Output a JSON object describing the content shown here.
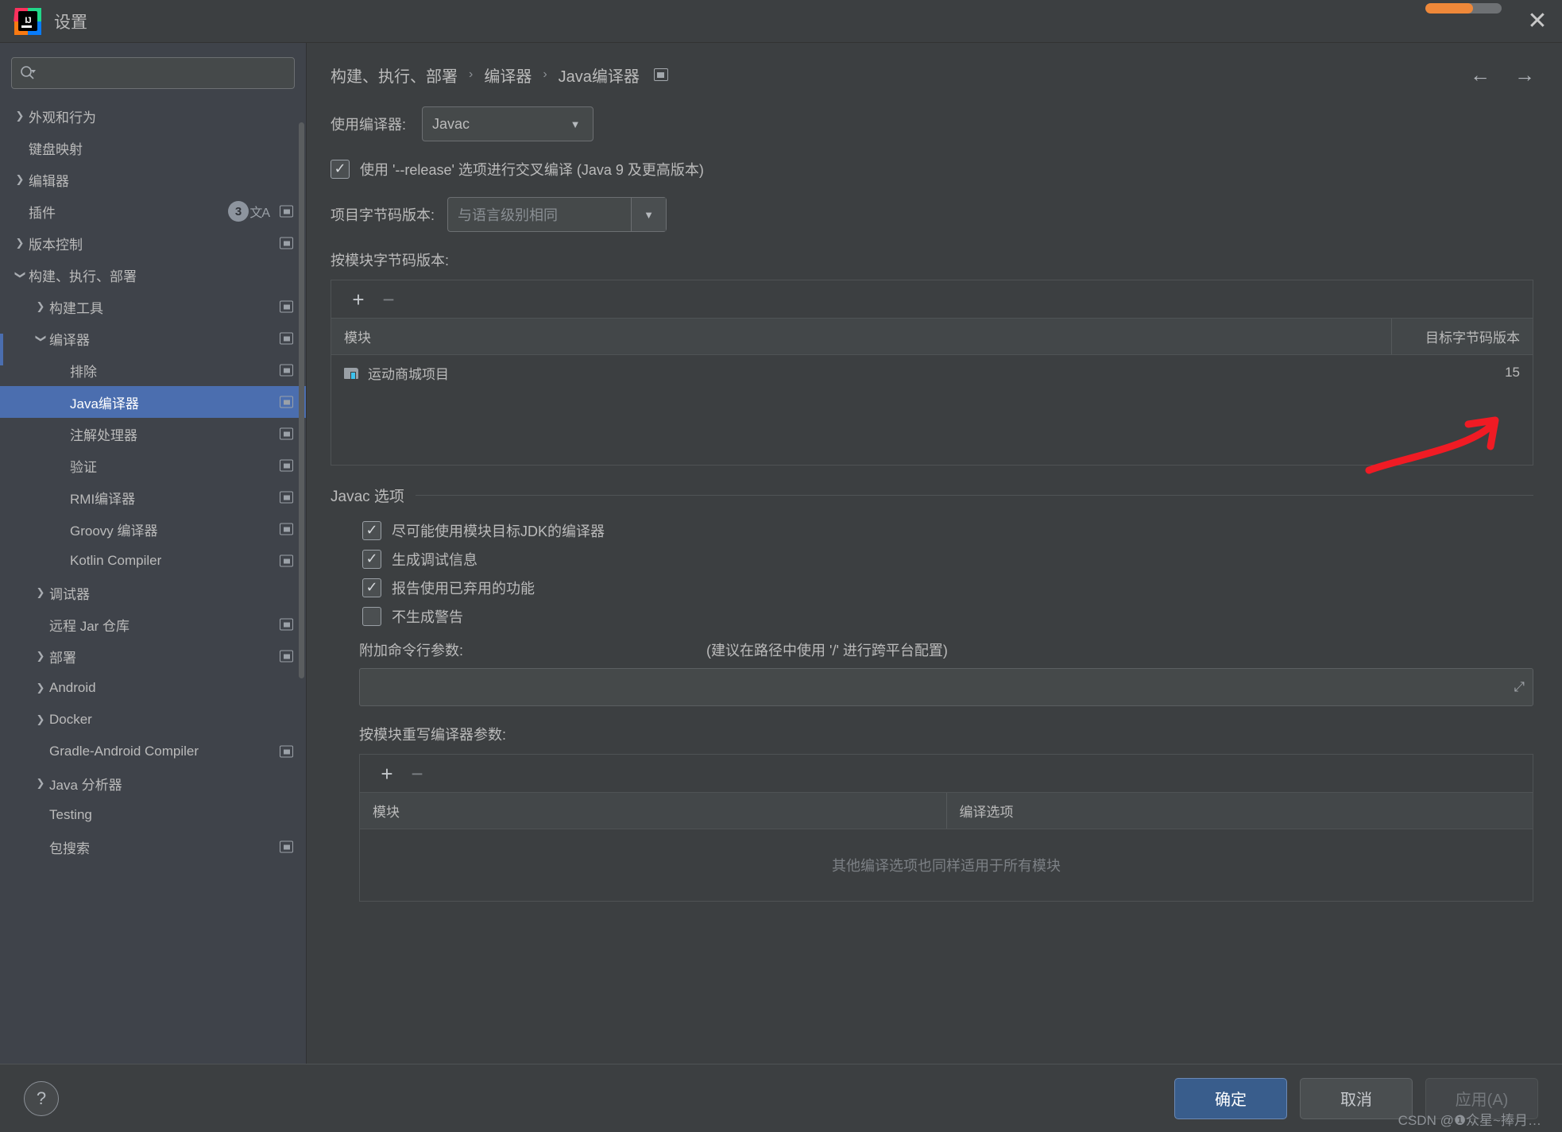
{
  "window": {
    "title": "设置",
    "logo_text": "IJ",
    "close_icon": "✕",
    "progress_percent": 62
  },
  "sidebar": {
    "search": {
      "value": "",
      "placeholder": ""
    },
    "items": [
      {
        "label": "外观和行为",
        "indent": 0,
        "arrow": "right",
        "selected": false
      },
      {
        "label": "键盘映射",
        "indent": 0,
        "arrow": "none",
        "selected": false
      },
      {
        "label": "编辑器",
        "indent": 0,
        "arrow": "right",
        "selected": false
      },
      {
        "label": "插件",
        "indent": 0,
        "arrow": "none",
        "selected": false,
        "badge": "3",
        "translate_icon": true,
        "gear": true
      },
      {
        "label": "版本控制",
        "indent": 0,
        "arrow": "right",
        "selected": false,
        "gear": true
      },
      {
        "label": "构建、执行、部署",
        "indent": 0,
        "arrow": "down",
        "selected": false
      },
      {
        "label": "构建工具",
        "indent": 1,
        "arrow": "right",
        "selected": false,
        "gear": true
      },
      {
        "label": "编译器",
        "indent": 1,
        "arrow": "down",
        "selected": false,
        "gear": true
      },
      {
        "label": "排除",
        "indent": 2,
        "arrow": "none",
        "selected": false,
        "gear": true
      },
      {
        "label": "Java编译器",
        "indent": 2,
        "arrow": "none",
        "selected": true,
        "gear": true
      },
      {
        "label": "注解处理器",
        "indent": 2,
        "arrow": "none",
        "selected": false,
        "gear": true
      },
      {
        "label": "验证",
        "indent": 2,
        "arrow": "none",
        "selected": false,
        "gear": true
      },
      {
        "label": "RMI编译器",
        "indent": 2,
        "arrow": "none",
        "selected": false,
        "gear": true
      },
      {
        "label": "Groovy 编译器",
        "indent": 2,
        "arrow": "none",
        "selected": false,
        "gear": true
      },
      {
        "label": "Kotlin Compiler",
        "indent": 2,
        "arrow": "none",
        "selected": false,
        "gear": true
      },
      {
        "label": "调试器",
        "indent": 1,
        "arrow": "right",
        "selected": false
      },
      {
        "label": "远程 Jar 仓库",
        "indent": 1,
        "arrow": "none",
        "selected": false,
        "gear": true
      },
      {
        "label": "部署",
        "indent": 1,
        "arrow": "right",
        "selected": false,
        "gear": true
      },
      {
        "label": "Android",
        "indent": 1,
        "arrow": "right",
        "selected": false
      },
      {
        "label": "Docker",
        "indent": 1,
        "arrow": "right",
        "selected": false
      },
      {
        "label": "Gradle-Android Compiler",
        "indent": 1,
        "arrow": "none",
        "selected": false,
        "gear": true
      },
      {
        "label": "Java 分析器",
        "indent": 1,
        "arrow": "right",
        "selected": false
      },
      {
        "label": "Testing",
        "indent": 1,
        "arrow": "none",
        "selected": false
      },
      {
        "label": "包搜索",
        "indent": 1,
        "arrow": "none",
        "selected": false,
        "gear": true
      }
    ]
  },
  "breadcrumb": {
    "items": [
      "构建、执行、部署",
      "编译器",
      "Java编译器"
    ],
    "separator": "›"
  },
  "main": {
    "compiler_label": "使用编译器:",
    "compiler_value": "Javac",
    "release_checkbox": {
      "label": "使用 '--release' 选项进行交叉编译 (Java 9 及更高版本)",
      "checked": true
    },
    "project_bytecode_label": "项目字节码版本:",
    "project_bytecode_placeholder": "与语言级别相同",
    "per_module_label": "按模块字节码版本:",
    "module_table": {
      "add_icon": "+",
      "remove_icon": "−",
      "columns": [
        "模块",
        "目标字节码版本"
      ],
      "rows": [
        {
          "module": "运动商城项目",
          "target": "15"
        }
      ]
    },
    "javac_group_title": "Javac 选项",
    "javac_options": [
      {
        "label": "尽可能使用模块目标JDK的编译器",
        "checked": true
      },
      {
        "label": "生成调试信息",
        "checked": true
      },
      {
        "label": "报告使用已弃用的功能",
        "checked": true
      },
      {
        "label": "不生成警告",
        "checked": false
      }
    ],
    "extra_args_label": "附加命令行参数:",
    "extra_args_hint": "(建议在路径中使用 '/' 进行跨平台配置)",
    "extra_args_value": "",
    "override_label": "按模块重写编译器参数:",
    "override_table": {
      "add_icon": "+",
      "remove_icon": "−",
      "columns": [
        "模块",
        "编译选项"
      ],
      "empty_message": "其他编译选项也同样适用于所有模块"
    }
  },
  "footer": {
    "help_icon": "?",
    "ok_label": "确定",
    "cancel_label": "取消",
    "apply_label": "应用(A)",
    "watermark": "CSDN @❶众星~捧月…"
  },
  "colors": {
    "accent": "#4b6eaf",
    "annotation": "#f01b24",
    "progress": "#ef8839"
  }
}
